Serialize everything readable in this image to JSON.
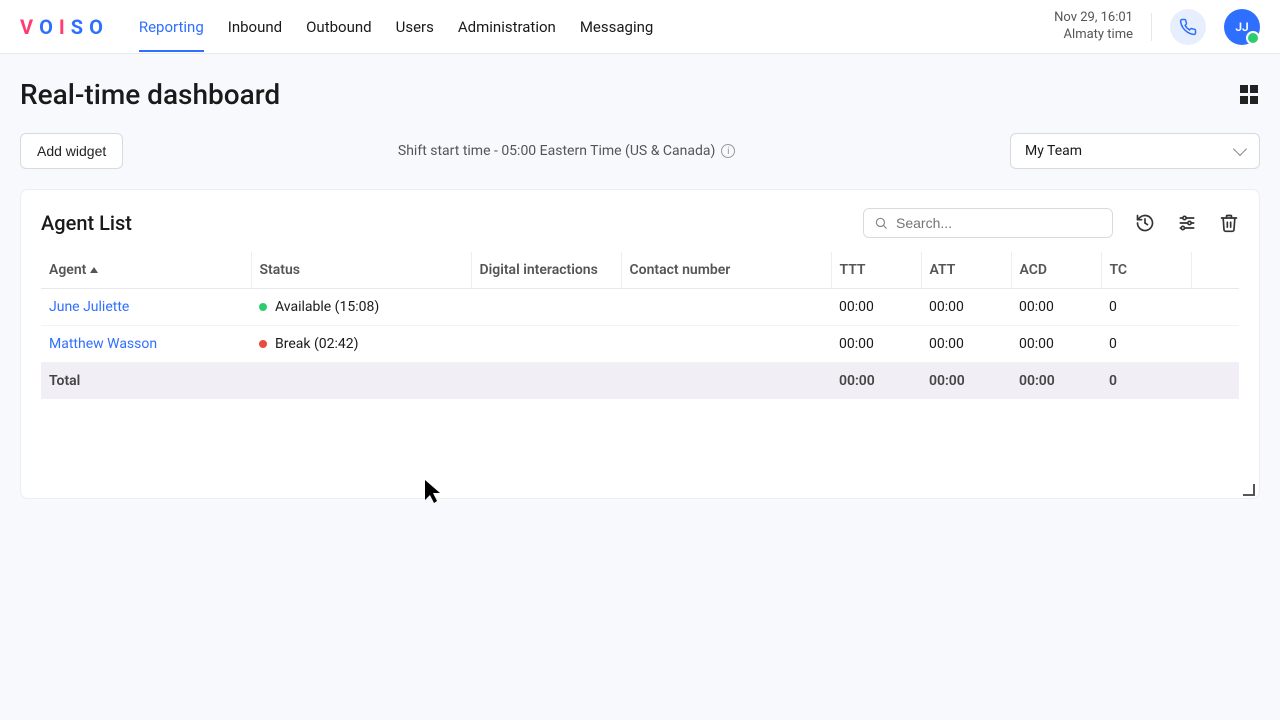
{
  "header": {
    "logo_letters": "VOISO",
    "nav": [
      "Reporting",
      "Inbound",
      "Outbound",
      "Users",
      "Administration",
      "Messaging"
    ],
    "active_nav_index": 0,
    "date": "Nov 29, 16:01",
    "timezone": "Almaty time",
    "avatar_initials": "JJ"
  },
  "page": {
    "title": "Real-time dashboard",
    "add_widget_label": "Add widget",
    "shift_info": "Shift start time - 05:00 Eastern Time (US & Canada)",
    "team_selected": "My Team"
  },
  "widget": {
    "title": "Agent List",
    "search_placeholder": "Search...",
    "columns": [
      "Agent",
      "Status",
      "Digital interactions",
      "Contact number",
      "TTT",
      "ATT",
      "ACD",
      "TC"
    ],
    "rows": [
      {
        "agent": "June Juliette",
        "status_text": "Available (15:08)",
        "status_color": "green",
        "digital": "",
        "contact": "",
        "ttt": "00:00",
        "att": "00:00",
        "acd": "00:00",
        "tc": "0"
      },
      {
        "agent": "Matthew Wasson",
        "status_text": "Break (02:42)",
        "status_color": "red",
        "digital": "",
        "contact": "",
        "ttt": "00:00",
        "att": "00:00",
        "acd": "00:00",
        "tc": "0"
      }
    ],
    "total": {
      "label": "Total",
      "ttt": "00:00",
      "att": "00:00",
      "acd": "00:00",
      "tc": "0"
    }
  }
}
